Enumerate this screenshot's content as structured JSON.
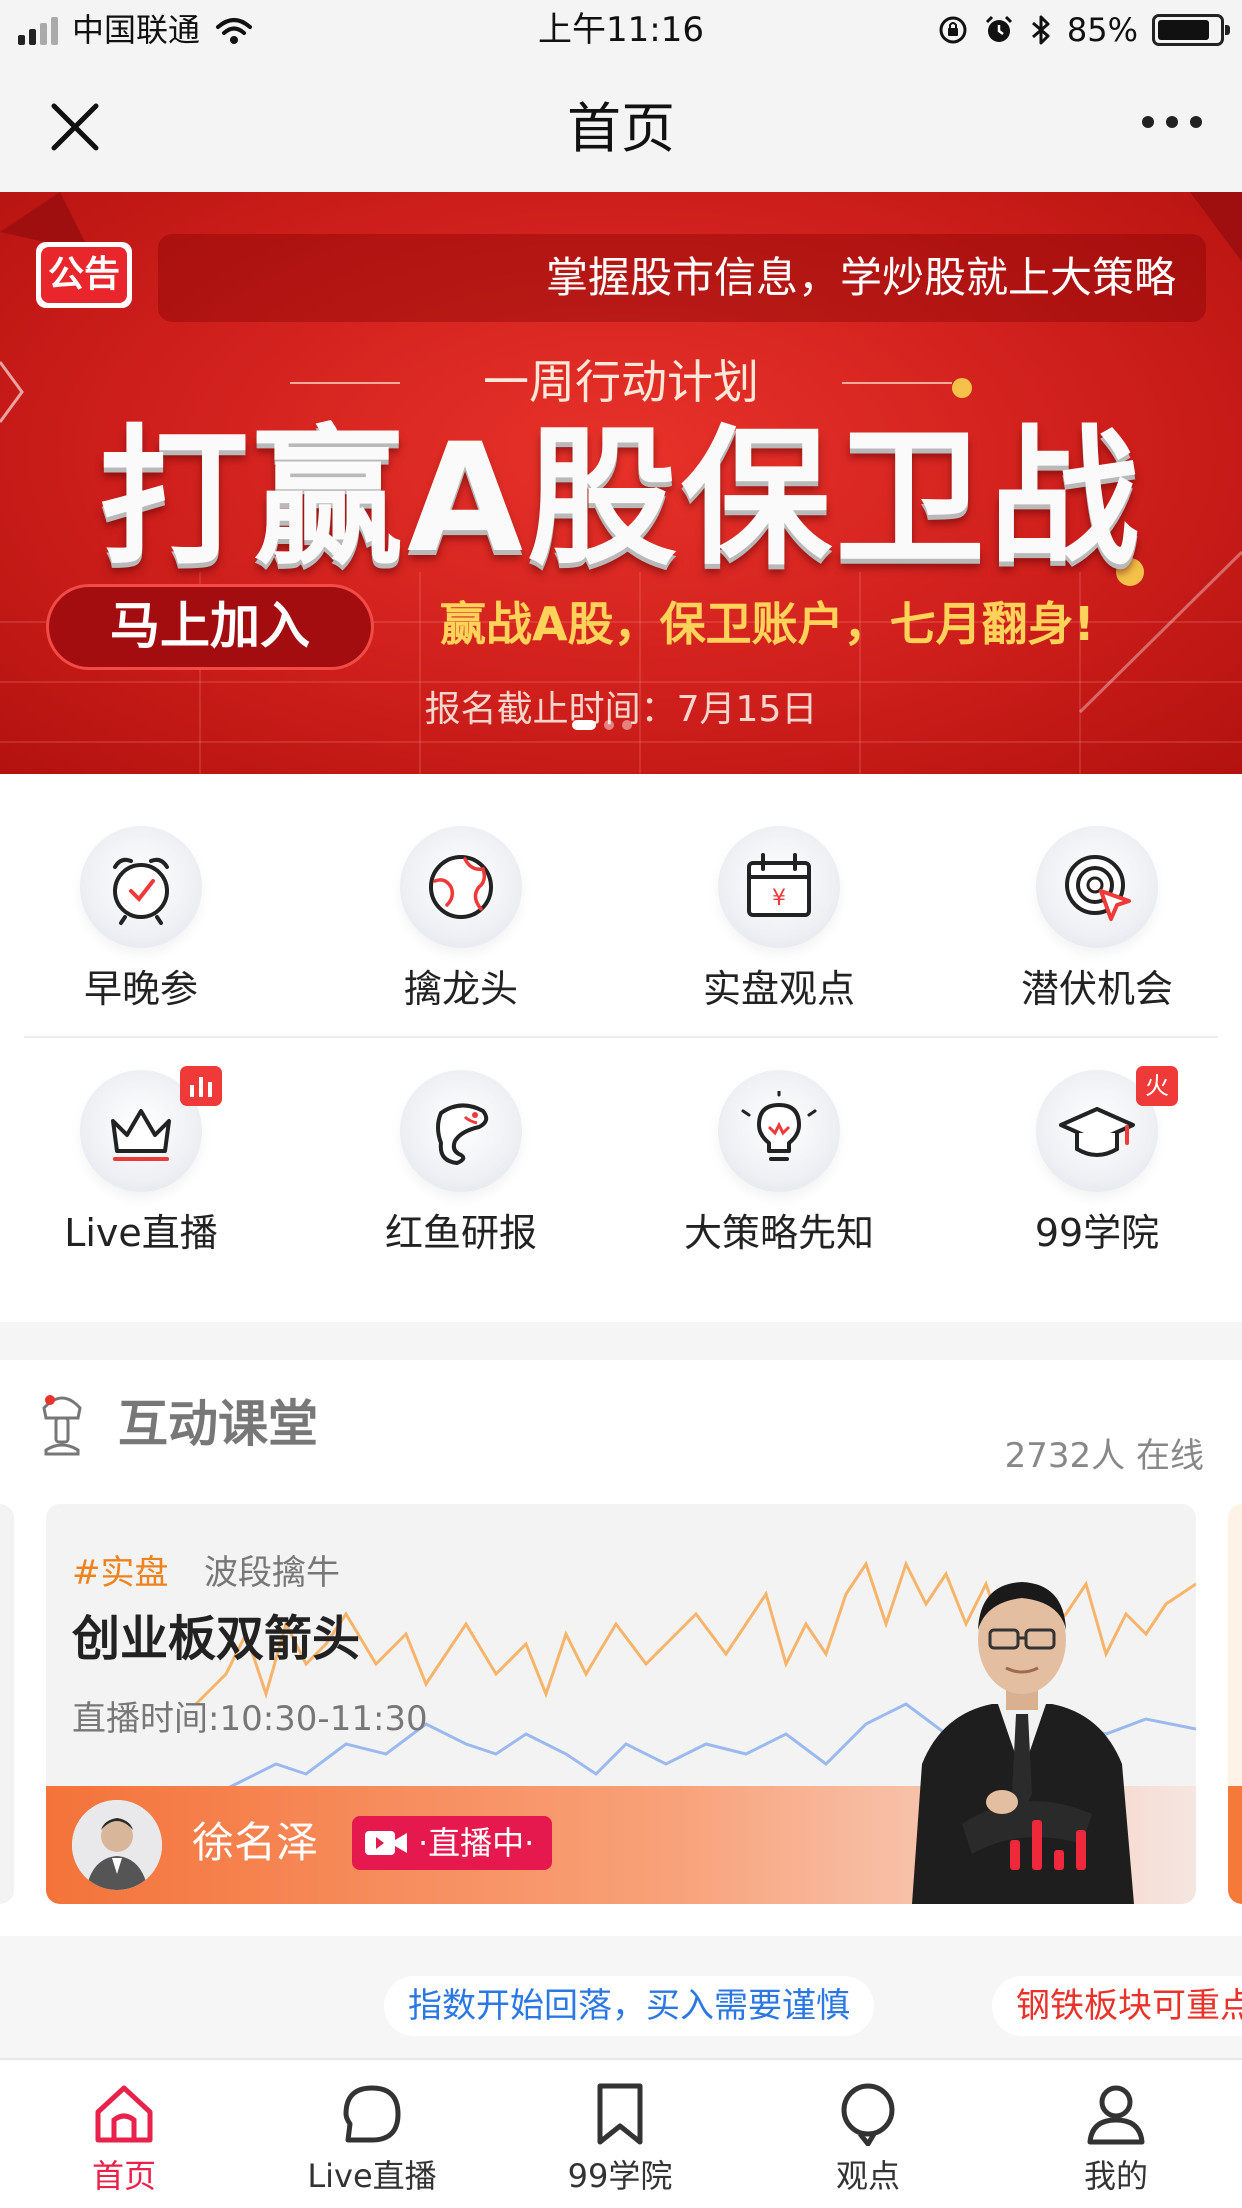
{
  "status_bar": {
    "carrier": "中国联通",
    "time": "上午11:16",
    "battery": "85%",
    "battery_level": 0.85
  },
  "nav": {
    "title": "首页",
    "close_icon": "close-icon",
    "more_icon": "more-icon"
  },
  "banner": {
    "notice_tag": "公告",
    "notice_text": "掌握股市信息，学炒股就上大策略",
    "subtitle": "一周行动计划",
    "title": "打赢A股保卫战",
    "join_button": "马上加入",
    "slogan": "赢战A股，保卫账户，七月翻身!",
    "deadline": "报名截止时间：7月15日",
    "slide_count": 3,
    "active_slide": 1,
    "colors": {
      "bg": "#cf1f1c",
      "slogan": "#ffd25a"
    }
  },
  "menu": {
    "row1": [
      {
        "label": "早晚参",
        "icon": "alarm-clock-icon"
      },
      {
        "label": "擒龙头",
        "icon": "globe-icon"
      },
      {
        "label": "实盘观点",
        "icon": "calendar-icon"
      },
      {
        "label": "潜伏机会",
        "icon": "target-cursor-icon"
      }
    ],
    "row2": [
      {
        "label": "Live直播",
        "icon": "crown-icon",
        "badge_icon": "bar-chart-icon"
      },
      {
        "label": "红鱼研报",
        "icon": "fish-icon"
      },
      {
        "label": "大策略先知",
        "icon": "lightbulb-icon"
      },
      {
        "label": "99学院",
        "icon": "graduation-cap-icon",
        "badge": "火"
      }
    ]
  },
  "classroom": {
    "title": "互动课堂",
    "online": "2732人 在线",
    "card": {
      "tag": "#实盘",
      "subtitle": "波段擒牛",
      "title": "创业板双箭头",
      "time": "直播时间:10:30-11:30",
      "teacher": "徐名泽",
      "live_label": "·直播中·"
    }
  },
  "ticker": {
    "items": [
      {
        "text": "指数开始回落，买入需要谨慎",
        "color": "#2b78e4"
      },
      {
        "text": "钢铁板块可重点关注",
        "color": "#e8322a"
      }
    ]
  },
  "tabbar": {
    "tabs": [
      {
        "label": "首页",
        "icon": "home-icon",
        "active": true
      },
      {
        "label": "Live直播",
        "icon": "live-bubble-icon",
        "active": false
      },
      {
        "label": "99学院",
        "icon": "bookmark-icon",
        "active": false
      },
      {
        "label": "观点",
        "icon": "chat-bubble-icon",
        "active": false
      },
      {
        "label": "我的",
        "icon": "user-icon",
        "active": false
      }
    ],
    "active_color": "#e8224a"
  }
}
